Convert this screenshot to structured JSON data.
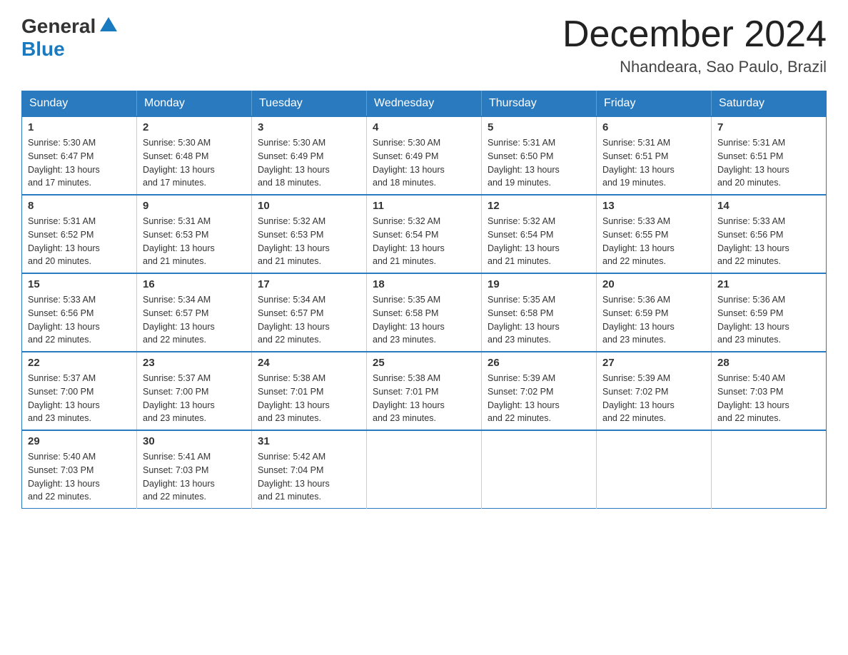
{
  "header": {
    "logo_general": "General",
    "logo_blue": "Blue",
    "month_title": "December 2024",
    "location": "Nhandeara, Sao Paulo, Brazil"
  },
  "days_of_week": [
    "Sunday",
    "Monday",
    "Tuesday",
    "Wednesday",
    "Thursday",
    "Friday",
    "Saturday"
  ],
  "weeks": [
    [
      {
        "day": "1",
        "sunrise": "5:30 AM",
        "sunset": "6:47 PM",
        "daylight": "13 hours and 17 minutes."
      },
      {
        "day": "2",
        "sunrise": "5:30 AM",
        "sunset": "6:48 PM",
        "daylight": "13 hours and 17 minutes."
      },
      {
        "day": "3",
        "sunrise": "5:30 AM",
        "sunset": "6:49 PM",
        "daylight": "13 hours and 18 minutes."
      },
      {
        "day": "4",
        "sunrise": "5:30 AM",
        "sunset": "6:49 PM",
        "daylight": "13 hours and 18 minutes."
      },
      {
        "day": "5",
        "sunrise": "5:31 AM",
        "sunset": "6:50 PM",
        "daylight": "13 hours and 19 minutes."
      },
      {
        "day": "6",
        "sunrise": "5:31 AM",
        "sunset": "6:51 PM",
        "daylight": "13 hours and 19 minutes."
      },
      {
        "day": "7",
        "sunrise": "5:31 AM",
        "sunset": "6:51 PM",
        "daylight": "13 hours and 20 minutes."
      }
    ],
    [
      {
        "day": "8",
        "sunrise": "5:31 AM",
        "sunset": "6:52 PM",
        "daylight": "13 hours and 20 minutes."
      },
      {
        "day": "9",
        "sunrise": "5:31 AM",
        "sunset": "6:53 PM",
        "daylight": "13 hours and 21 minutes."
      },
      {
        "day": "10",
        "sunrise": "5:32 AM",
        "sunset": "6:53 PM",
        "daylight": "13 hours and 21 minutes."
      },
      {
        "day": "11",
        "sunrise": "5:32 AM",
        "sunset": "6:54 PM",
        "daylight": "13 hours and 21 minutes."
      },
      {
        "day": "12",
        "sunrise": "5:32 AM",
        "sunset": "6:54 PM",
        "daylight": "13 hours and 21 minutes."
      },
      {
        "day": "13",
        "sunrise": "5:33 AM",
        "sunset": "6:55 PM",
        "daylight": "13 hours and 22 minutes."
      },
      {
        "day": "14",
        "sunrise": "5:33 AM",
        "sunset": "6:56 PM",
        "daylight": "13 hours and 22 minutes."
      }
    ],
    [
      {
        "day": "15",
        "sunrise": "5:33 AM",
        "sunset": "6:56 PM",
        "daylight": "13 hours and 22 minutes."
      },
      {
        "day": "16",
        "sunrise": "5:34 AM",
        "sunset": "6:57 PM",
        "daylight": "13 hours and 22 minutes."
      },
      {
        "day": "17",
        "sunrise": "5:34 AM",
        "sunset": "6:57 PM",
        "daylight": "13 hours and 22 minutes."
      },
      {
        "day": "18",
        "sunrise": "5:35 AM",
        "sunset": "6:58 PM",
        "daylight": "13 hours and 23 minutes."
      },
      {
        "day": "19",
        "sunrise": "5:35 AM",
        "sunset": "6:58 PM",
        "daylight": "13 hours and 23 minutes."
      },
      {
        "day": "20",
        "sunrise": "5:36 AM",
        "sunset": "6:59 PM",
        "daylight": "13 hours and 23 minutes."
      },
      {
        "day": "21",
        "sunrise": "5:36 AM",
        "sunset": "6:59 PM",
        "daylight": "13 hours and 23 minutes."
      }
    ],
    [
      {
        "day": "22",
        "sunrise": "5:37 AM",
        "sunset": "7:00 PM",
        "daylight": "13 hours and 23 minutes."
      },
      {
        "day": "23",
        "sunrise": "5:37 AM",
        "sunset": "7:00 PM",
        "daylight": "13 hours and 23 minutes."
      },
      {
        "day": "24",
        "sunrise": "5:38 AM",
        "sunset": "7:01 PM",
        "daylight": "13 hours and 23 minutes."
      },
      {
        "day": "25",
        "sunrise": "5:38 AM",
        "sunset": "7:01 PM",
        "daylight": "13 hours and 23 minutes."
      },
      {
        "day": "26",
        "sunrise": "5:39 AM",
        "sunset": "7:02 PM",
        "daylight": "13 hours and 22 minutes."
      },
      {
        "day": "27",
        "sunrise": "5:39 AM",
        "sunset": "7:02 PM",
        "daylight": "13 hours and 22 minutes."
      },
      {
        "day": "28",
        "sunrise": "5:40 AM",
        "sunset": "7:03 PM",
        "daylight": "13 hours and 22 minutes."
      }
    ],
    [
      {
        "day": "29",
        "sunrise": "5:40 AM",
        "sunset": "7:03 PM",
        "daylight": "13 hours and 22 minutes."
      },
      {
        "day": "30",
        "sunrise": "5:41 AM",
        "sunset": "7:03 PM",
        "daylight": "13 hours and 22 minutes."
      },
      {
        "day": "31",
        "sunrise": "5:42 AM",
        "sunset": "7:04 PM",
        "daylight": "13 hours and 21 minutes."
      },
      null,
      null,
      null,
      null
    ]
  ],
  "labels": {
    "sunrise": "Sunrise:",
    "sunset": "Sunset:",
    "daylight": "Daylight:"
  }
}
